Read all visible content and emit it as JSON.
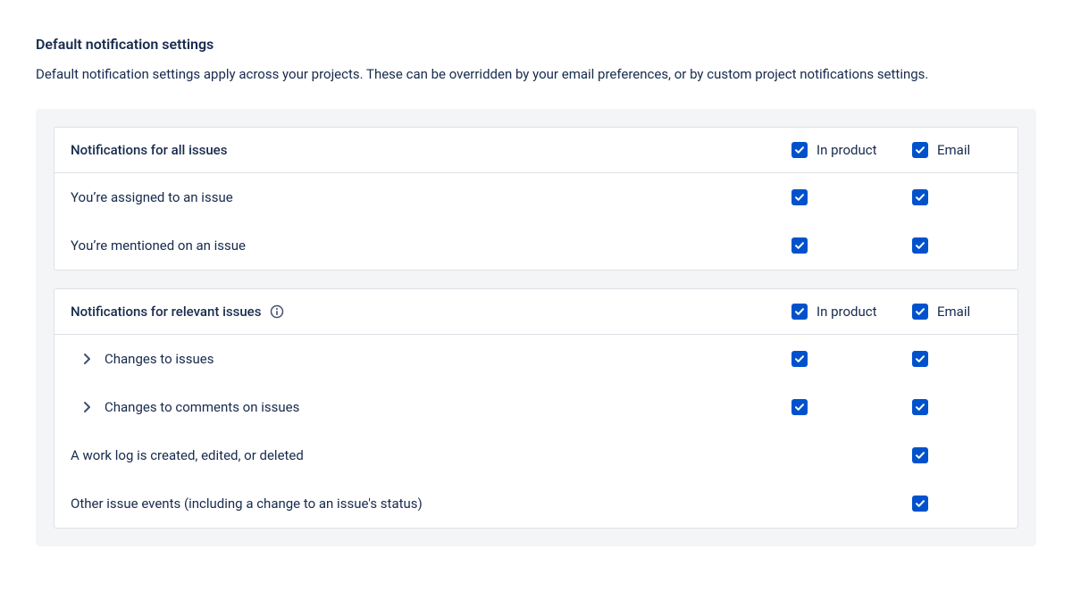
{
  "page": {
    "title": "Default notification settings",
    "description": "Default notification settings apply across your projects. These can be overridden by your email preferences, or by custom project notifications settings."
  },
  "columns": {
    "in_product": "In product",
    "email": "Email"
  },
  "group1": {
    "title": "Notifications for all issues",
    "rows": {
      "assigned": "You’re assigned to an issue",
      "mentioned": "You’re mentioned on an issue"
    }
  },
  "group2": {
    "title": "Notifications for relevant issues",
    "rows": {
      "changes_issues": "Changes to issues",
      "changes_comments": "Changes to comments on issues",
      "worklog": "A work log is created, edited, or deleted",
      "other": "Other issue events (including a change to an issue's status)"
    }
  }
}
